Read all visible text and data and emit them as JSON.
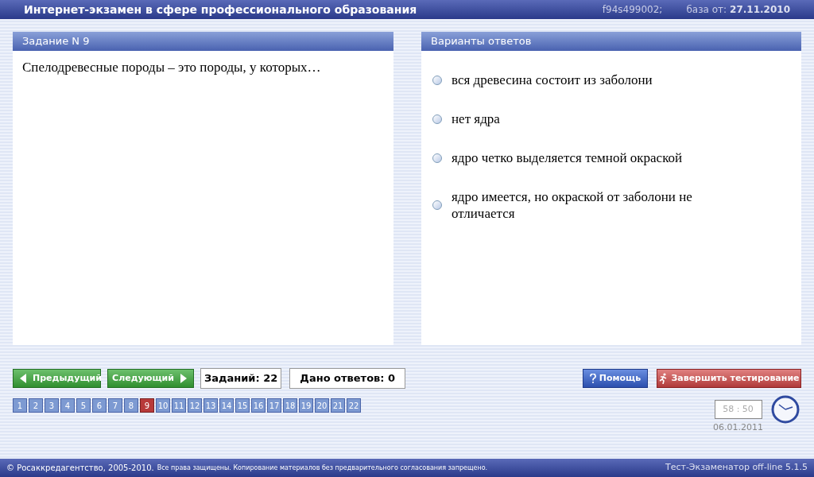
{
  "header": {
    "title": "Интернет-экзамен в сфере профессионального образования",
    "code": "f94s499002;",
    "base_label": "база от:",
    "base_date": "27.11.2010"
  },
  "task": {
    "title": "Задание N 9",
    "question": "Спелодревесные породы – это породы, у которых…"
  },
  "answers": {
    "title": "Варианты ответов",
    "options": [
      {
        "text": "вся древесина состоит из заболони",
        "selected": false
      },
      {
        "text": "нет ядра",
        "selected": false
      },
      {
        "text": "ядро четко выделяется темной окраской",
        "selected": false
      },
      {
        "text": "ядро имеется, но окраской от заболони не отличается",
        "selected": false
      }
    ]
  },
  "nav": {
    "prev": "Предыдущий",
    "next": "Следующий",
    "total": "Заданий: 22",
    "answered": "Дано ответов: 0",
    "help": "Помощь",
    "finish": "Завершить тестирование"
  },
  "pages": [
    {
      "label": "1",
      "selected": false
    },
    {
      "label": "2",
      "selected": false
    },
    {
      "label": "3",
      "selected": false
    },
    {
      "label": "4",
      "selected": false
    },
    {
      "label": "5",
      "selected": false
    },
    {
      "label": "6",
      "selected": false
    },
    {
      "label": "7",
      "selected": false
    },
    {
      "label": "8",
      "selected": false
    },
    {
      "label": "9",
      "selected": true
    },
    {
      "label": "10",
      "selected": false
    },
    {
      "label": "11",
      "selected": false
    },
    {
      "label": "12",
      "selected": false
    },
    {
      "label": "13",
      "selected": false
    },
    {
      "label": "14",
      "selected": false
    },
    {
      "label": "15",
      "selected": false
    },
    {
      "label": "16",
      "selected": false
    },
    {
      "label": "17",
      "selected": false
    },
    {
      "label": "18",
      "selected": false
    },
    {
      "label": "19",
      "selected": false
    },
    {
      "label": "20",
      "selected": false
    },
    {
      "label": "21",
      "selected": false
    },
    {
      "label": "22",
      "selected": false
    }
  ],
  "timer": {
    "time": "58 : 50",
    "date": "06.01.2011"
  },
  "footer": {
    "copyright": "© Росаккредагентство, 2005-2010.",
    "notice": "Все права защищены. Копирование материалов без предварительного согласования запрещено.",
    "version": "Тест-Экзаменатор off-line 5.1.5"
  }
}
